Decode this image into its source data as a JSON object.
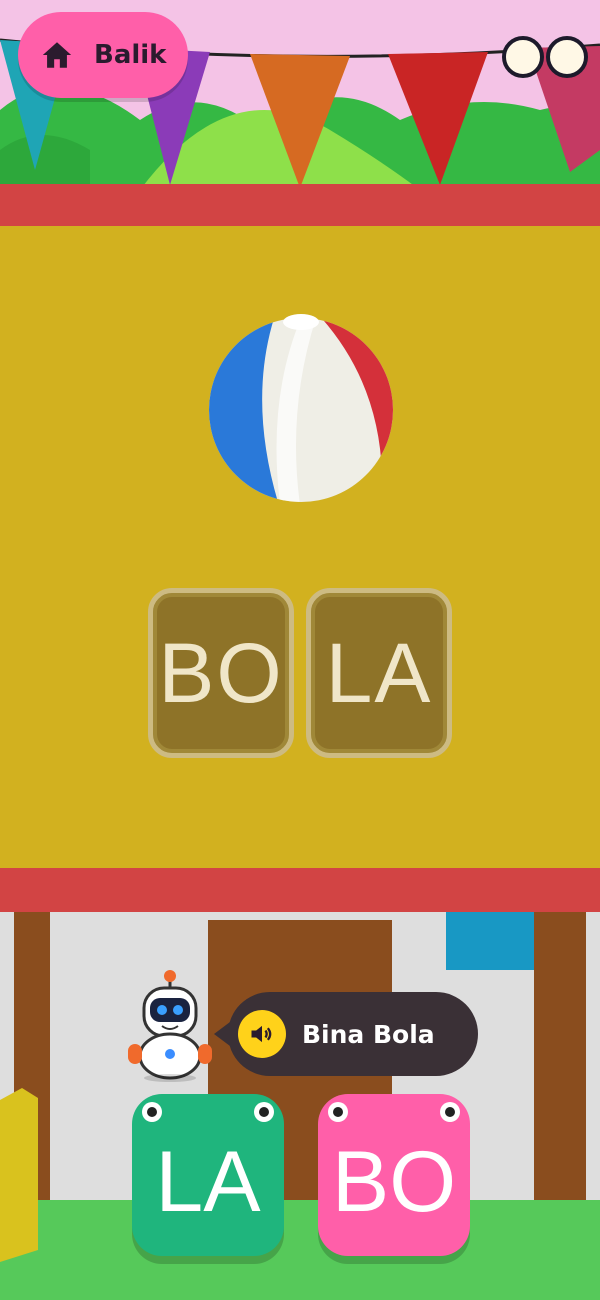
{
  "header": {
    "back_label": "Balik",
    "home_icon": "home-icon"
  },
  "colors": {
    "board": "#d2b11f",
    "beam": "#d24444",
    "tile_la": "#1fb57d",
    "tile_bo": "#ff5fa9",
    "bubble": "#3a3036",
    "speaker": "#ffd21a"
  },
  "puzzle": {
    "picture": "beach-ball",
    "slots": [
      "BO",
      "LA"
    ]
  },
  "hint": {
    "text": "Bina Bola",
    "speaker_icon": "speaker-icon"
  },
  "choices": [
    {
      "label": "LA"
    },
    {
      "label": "BO"
    }
  ]
}
